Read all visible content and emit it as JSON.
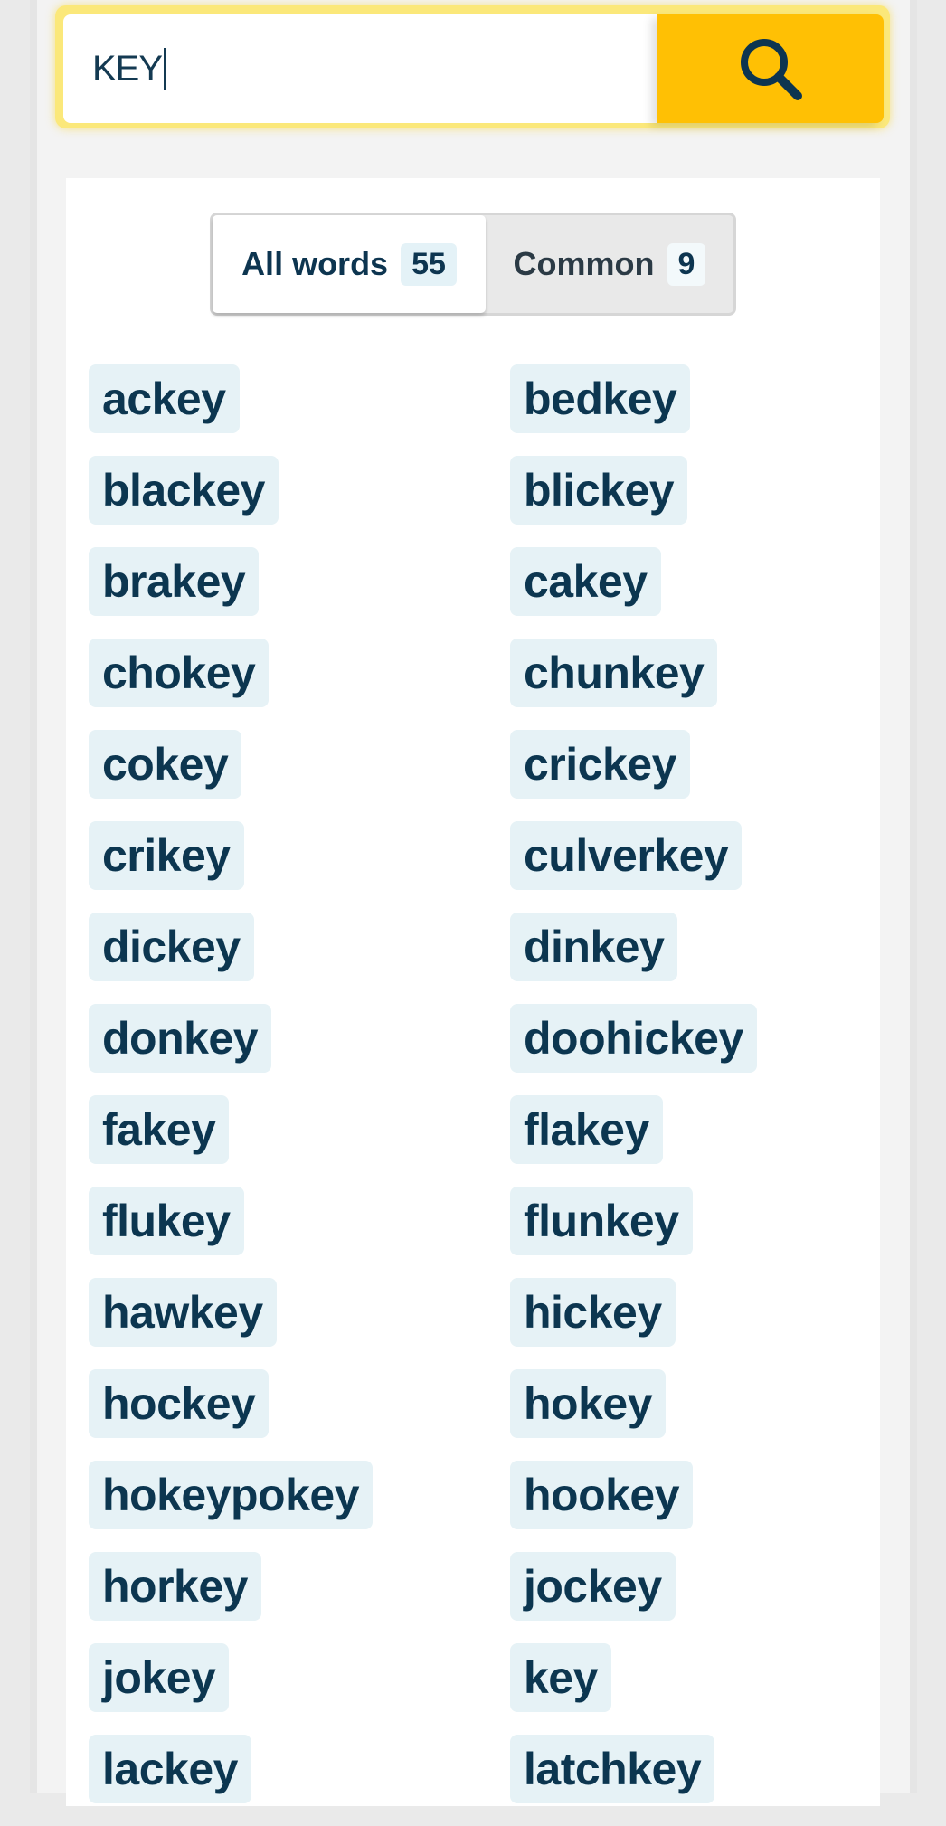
{
  "search": {
    "value": "KEY",
    "button_icon": "search-icon",
    "accent_color": "#ffc004"
  },
  "tabs": [
    {
      "label": "All words",
      "count": "55",
      "active": true
    },
    {
      "label": "Common",
      "count": "9",
      "active": false
    }
  ],
  "words": [
    [
      "ackey",
      "bedkey"
    ],
    [
      "blackey",
      "blickey"
    ],
    [
      "brakey",
      "cakey"
    ],
    [
      "chokey",
      "chunkey"
    ],
    [
      "cokey",
      "crickey"
    ],
    [
      "crikey",
      "culverkey"
    ],
    [
      "dickey",
      "dinkey"
    ],
    [
      "donkey",
      "doohickey"
    ],
    [
      "fakey",
      "flakey"
    ],
    [
      "flukey",
      "flunkey"
    ],
    [
      "hawkey",
      "hickey"
    ],
    [
      "hockey",
      "hokey"
    ],
    [
      "hokeypokey",
      "hookey"
    ],
    [
      "horkey",
      "jockey"
    ],
    [
      "jokey",
      "key"
    ],
    [
      "lackey",
      "latchkey"
    ]
  ]
}
